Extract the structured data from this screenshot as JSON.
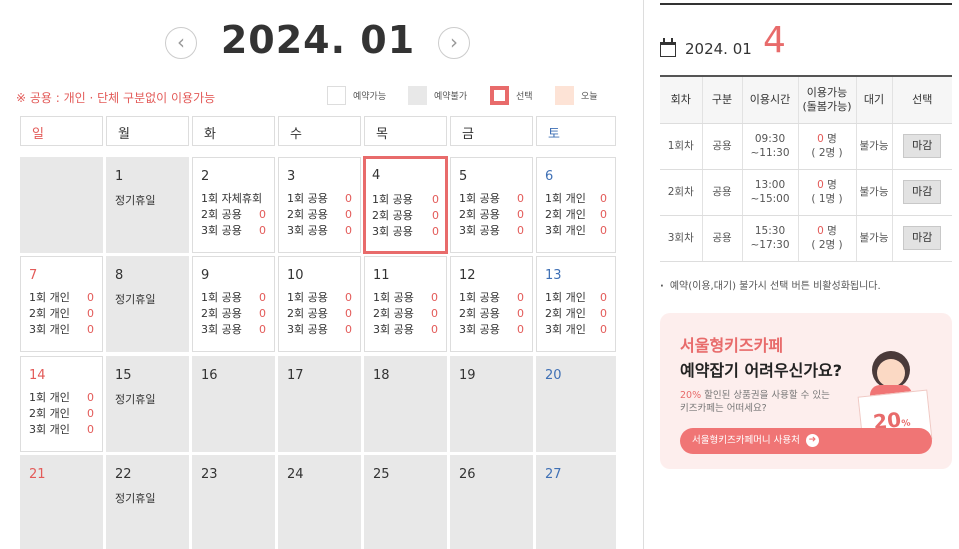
{
  "calendar": {
    "title": "2024. 01",
    "prev_label": "‹",
    "next_label": "›",
    "notice": "※ 공용 : 개인 · 단체 구분없이 이용가능",
    "legend": {
      "available": "예약가능",
      "unavailable": "예약불가",
      "selected": "선택",
      "today": "오늘"
    },
    "weekdays": [
      "일",
      "월",
      "화",
      "수",
      "목",
      "금",
      "토"
    ],
    "closed_note": "정기휴일",
    "weeks": [
      [
        {
          "day": "",
          "closed": true
        },
        {
          "day": "1",
          "closed": true,
          "note": "정기휴일"
        },
        {
          "day": "2",
          "sessions": [
            {
              "label": "1회 자체휴회",
              "count": ""
            },
            {
              "label": "2회 공용",
              "count": "0"
            },
            {
              "label": "3회 공용",
              "count": "0"
            }
          ]
        },
        {
          "day": "3",
          "sessions": [
            {
              "label": "1회 공용",
              "count": "0"
            },
            {
              "label": "2회 공용",
              "count": "0"
            },
            {
              "label": "3회 공용",
              "count": "0"
            }
          ]
        },
        {
          "day": "4",
          "selected": true,
          "sessions": [
            {
              "label": "1회 공용",
              "count": "0"
            },
            {
              "label": "2회 공용",
              "count": "0"
            },
            {
              "label": "3회 공용",
              "count": "0"
            }
          ]
        },
        {
          "day": "5",
          "sessions": [
            {
              "label": "1회 공용",
              "count": "0"
            },
            {
              "label": "2회 공용",
              "count": "0"
            },
            {
              "label": "3회 공용",
              "count": "0"
            }
          ]
        },
        {
          "day": "6",
          "sessions": [
            {
              "label": "1회 개인",
              "count": "0"
            },
            {
              "label": "2회 개인",
              "count": "0"
            },
            {
              "label": "3회 개인",
              "count": "0"
            }
          ]
        }
      ],
      [
        {
          "day": "7",
          "sessions": [
            {
              "label": "1회 개인",
              "count": "0"
            },
            {
              "label": "2회 개인",
              "count": "0"
            },
            {
              "label": "3회 개인",
              "count": "0"
            }
          ]
        },
        {
          "day": "8",
          "closed": true,
          "note": "정기휴일"
        },
        {
          "day": "9",
          "sessions": [
            {
              "label": "1회 공용",
              "count": "0"
            },
            {
              "label": "2회 공용",
              "count": "0"
            },
            {
              "label": "3회 공용",
              "count": "0"
            }
          ]
        },
        {
          "day": "10",
          "sessions": [
            {
              "label": "1회 공용",
              "count": "0"
            },
            {
              "label": "2회 공용",
              "count": "0"
            },
            {
              "label": "3회 공용",
              "count": "0"
            }
          ]
        },
        {
          "day": "11",
          "sessions": [
            {
              "label": "1회 공용",
              "count": "0"
            },
            {
              "label": "2회 공용",
              "count": "0"
            },
            {
              "label": "3회 공용",
              "count": "0"
            }
          ]
        },
        {
          "day": "12",
          "sessions": [
            {
              "label": "1회 공용",
              "count": "0"
            },
            {
              "label": "2회 공용",
              "count": "0"
            },
            {
              "label": "3회 공용",
              "count": "0"
            }
          ]
        },
        {
          "day": "13",
          "sessions": [
            {
              "label": "1회 개인",
              "count": "0"
            },
            {
              "label": "2회 개인",
              "count": "0"
            },
            {
              "label": "3회 개인",
              "count": "0"
            }
          ]
        }
      ],
      [
        {
          "day": "14",
          "sessions": [
            {
              "label": "1회 개인",
              "count": "0"
            },
            {
              "label": "2회 개인",
              "count": "0"
            },
            {
              "label": "3회 개인",
              "count": "0"
            }
          ]
        },
        {
          "day": "15",
          "closed": true,
          "note": "정기휴일"
        },
        {
          "day": "16",
          "closed": true
        },
        {
          "day": "17",
          "closed": true
        },
        {
          "day": "18",
          "closed": true
        },
        {
          "day": "19",
          "closed": true
        },
        {
          "day": "20",
          "closed": true
        }
      ],
      [
        {
          "day": "21",
          "closed": true
        },
        {
          "day": "22",
          "closed": true,
          "note": "정기휴일"
        },
        {
          "day": "23",
          "closed": true
        },
        {
          "day": "24",
          "closed": true
        },
        {
          "day": "25",
          "closed": true
        },
        {
          "day": "26",
          "closed": true
        },
        {
          "day": "27",
          "closed": true
        }
      ]
    ]
  },
  "detail": {
    "year_month": "2024. 01",
    "day": "4",
    "headers": [
      "회차",
      "구분",
      "이용시간",
      "이용가능\n(돌봄가능)",
      "대기",
      "선택"
    ],
    "rows": [
      {
        "session": "1회차",
        "type": "공용",
        "time": "09:30\n~11:30",
        "avail": "0",
        "avail_unit": " 명",
        "care": "( 2명 )",
        "wait": "불가능",
        "button": "마감"
      },
      {
        "session": "2회차",
        "type": "공용",
        "time": "13:00\n~15:00",
        "avail": "0",
        "avail_unit": " 명",
        "care": "( 1명 )",
        "wait": "불가능",
        "button": "마감"
      },
      {
        "session": "3회차",
        "type": "공용",
        "time": "15:30\n~17:30",
        "avail": "0",
        "avail_unit": " 명",
        "care": "( 2명 )",
        "wait": "불가능",
        "button": "마감"
      }
    ],
    "note": "예약(이용,대기) 불가시 선택 버튼 비활성화됩니다."
  },
  "banner": {
    "brand": "서울형키즈카페",
    "title": "예약잡기 어려우신가요?",
    "desc_pct": "20%",
    "desc_line1": " 할인된 상품권을 사용할 수 있는",
    "desc_line2": "키즈카페는 어떠세요?",
    "button": "서울형키즈카페머니 사용처",
    "coupon_value": "20",
    "coupon_unit": "%"
  },
  "colors": {
    "accent": "#e86b6b",
    "sunday": "#e35b59",
    "saturday": "#3f70b5",
    "closed_bg": "#e8e8e8",
    "today_bg": "#fde3d6"
  }
}
